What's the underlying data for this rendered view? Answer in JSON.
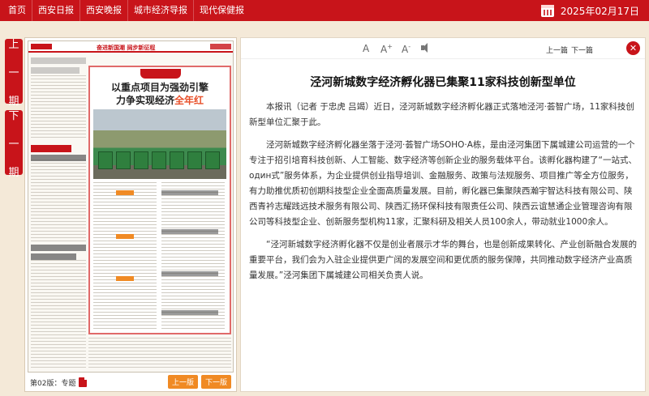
{
  "topnav": {
    "items": [
      "首页",
      "西安日报",
      "西安晚报",
      "城市经济导报",
      "现代保健报"
    ],
    "date": "2025年02月17日"
  },
  "side": {
    "prev": [
      "上",
      "一",
      "期"
    ],
    "next": [
      "下",
      "一",
      "期"
    ]
  },
  "page": {
    "label": "第02版：专题",
    "prev_btn": "上一版",
    "next_btn": "下一版",
    "thumb": {
      "slogan": "奋进新国潮  阔步新征程",
      "title1": "以重点项目为强劲引擎",
      "title2_main": "力争实现经济",
      "title2_highlight": "全年红"
    }
  },
  "toolbar": {
    "font_a": "A",
    "font_increase": "A",
    "font_decrease": "A",
    "plus": "+",
    "minus": "-",
    "prev_article": "上一篇",
    "next_article": "下一篇",
    "close_glyph": "✕"
  },
  "article": {
    "title": "泾河新城数字经济孵化器已集聚11家科技创新型单位",
    "paragraphs": [
      "本报讯（记者 于忠虎 吕竭）近日，泾河新城数字经济孵化器正式落地泾河·荟智广场，11家科技创新型单位汇聚于此。",
      "泾河新城数字经济孵化器坐落于泾河·荟智广场SOHO·A栋，是由泾河集团下属城建公司运营的一个专注于招引培育科技创新、人工智能、数字经济等创新企业的服务载体平台。该孵化器构建了“一站式、один式”服务体系，为企业提供创业指导培训、金融服务、政策与法规服务、项目推广等全方位服务，有力助推优质初创期科技型企业全面高质量发展。目前，孵化器已集聚陕西瀚宇智达科技有限公司、陕西青衿志耀践远技术服务有限公司、陕西汇扬环保科技有限责任公司、陕西云谊慧通企业管理咨询有限公司等科技型企业、创新服务型机构11家，汇聚科研及相关人员100余人，带动就业1000余人。",
      "“泾河新城数字经济孵化器不仅是创业者展示才华的舞台，也是创新成果转化、产业创新融合发展的重要平台，我们会为入驻企业提供更广阔的发展空间和更优质的服务保障，共同推动数字经济产业高质量发展。”泾河集团下属城建公司相关负责人说。"
    ]
  }
}
